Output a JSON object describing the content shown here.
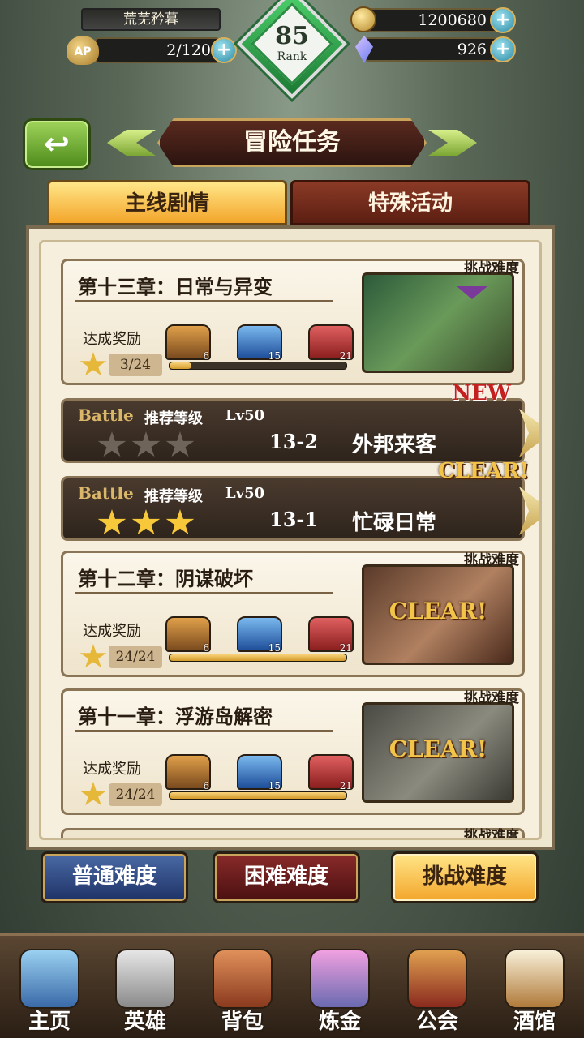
{
  "player": {
    "name": "荒芜矜暮",
    "ap": "2/120",
    "ap_icon_label": "AP",
    "rank": "85",
    "rank_label": "Rank",
    "gold": "1200680",
    "gems": "926"
  },
  "header": {
    "title": "冒险任务"
  },
  "tabs": [
    {
      "label": "主线剧情",
      "active": true
    },
    {
      "label": "特殊活动",
      "active": false
    }
  ],
  "chapters": [
    {
      "title": "第十三章：日常与异变",
      "reward_label": "达成奖励",
      "reward_count": "3/24",
      "progress": 0.125,
      "chests": [
        "6",
        "15",
        "21"
      ],
      "difficulty_tag": "挑战难度",
      "clear": ""
    },
    {
      "title": "第十二章：阴谋破坏",
      "reward_label": "达成奖励",
      "reward_count": "24/24",
      "progress": 1.0,
      "chests": [
        "6",
        "15",
        "21"
      ],
      "difficulty_tag": "挑战难度",
      "clear": "CLEAR!"
    },
    {
      "title": "第十一章：浮游岛解密",
      "reward_label": "达成奖励",
      "reward_count": "24/24",
      "progress": 1.0,
      "chests": [
        "6",
        "15",
        "21"
      ],
      "difficulty_tag": "挑战难度",
      "clear": "CLEAR!"
    }
  ],
  "stages": [
    {
      "battle": "Battle",
      "rec_label": "推荐等级",
      "level": "Lv50",
      "stars": 0,
      "code": "13-2",
      "name": "外邦来客",
      "badge": "NEW"
    },
    {
      "battle": "Battle",
      "rec_label": "推荐等级",
      "level": "Lv50",
      "stars": 3,
      "code": "13-1",
      "name": "忙碌日常",
      "badge": "CLEAR!"
    }
  ],
  "peek_tag": "挑战难度",
  "difficulty_buttons": {
    "normal": "普通难度",
    "hard": "困难难度",
    "challenge": "挑战难度"
  },
  "nav": [
    {
      "label": "主页",
      "icon": "castle-icon"
    },
    {
      "label": "英雄",
      "icon": "knight-helmet-icon"
    },
    {
      "label": "背包",
      "icon": "satchel-icon"
    },
    {
      "label": "炼金",
      "icon": "potion-icon"
    },
    {
      "label": "公会",
      "icon": "guild-shield-icon"
    },
    {
      "label": "酒馆",
      "icon": "beer-mug-icon"
    }
  ]
}
